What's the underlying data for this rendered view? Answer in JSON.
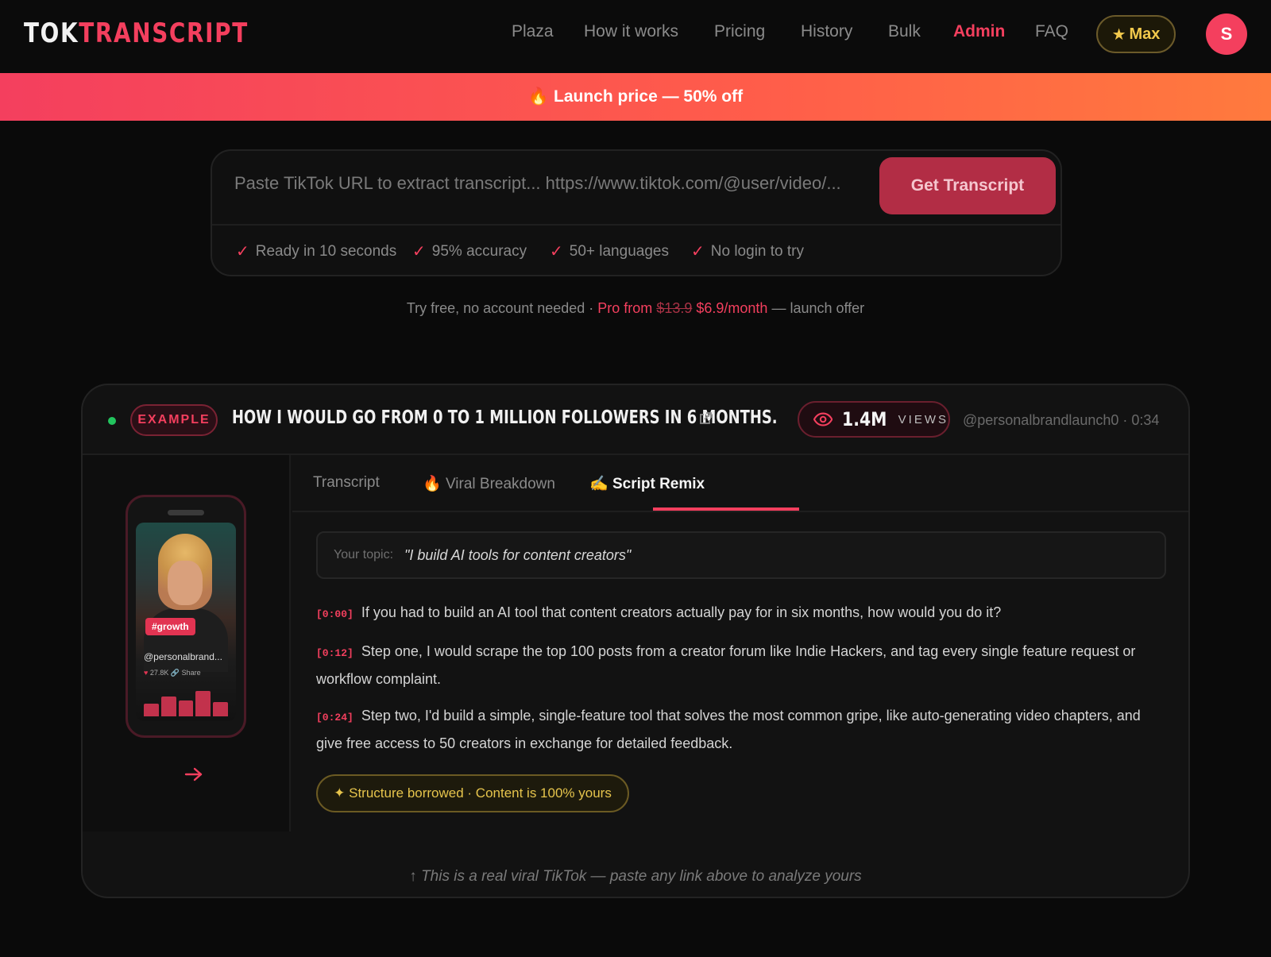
{
  "header": {
    "logo_part1": "TOK",
    "logo_part2": "TRANSCRIPT",
    "nav": [
      "Plaza",
      "How it works",
      "Pricing",
      "History",
      "Bulk",
      "Admin",
      "FAQ"
    ],
    "active_nav": "Admin",
    "max_label": "Max",
    "avatar_initial": "S"
  },
  "banner": {
    "emoji": "🔥",
    "text": "Launch price — 50% off"
  },
  "search": {
    "placeholder": "Paste TikTok URL to extract transcript... https://www.tiktok.com/@user/video/...",
    "button": "Get Transcript",
    "features": [
      "Ready in 10 seconds",
      "95% accuracy",
      "50+ languages",
      "No login to try"
    ]
  },
  "tagline": {
    "prefix": "Try free, no account needed · ",
    "pro_from": "Pro from",
    "old_price": "$13.9",
    "new_price": "$6.9/month",
    "suffix": " — launch offer"
  },
  "example": {
    "badge": "EXAMPLE",
    "title": "HOW I WOULD GO FROM 0 TO 1 MILLION FOLLOWERS IN 6 MONTHS.",
    "views_number": "1.4M",
    "views_label": "VIEWS",
    "author": "@personalbrandlaunch0 · 0:34",
    "phone": {
      "hashtag": "#growth",
      "handle": "@personalbrand...",
      "likes": "27.8K",
      "share": "Share",
      "bar_levels": [
        0.45,
        0.7,
        0.55,
        0.9,
        0.5
      ]
    },
    "tabs": [
      {
        "label": "Transcript",
        "icon": ""
      },
      {
        "label": "Viral Breakdown",
        "icon": "🔥"
      },
      {
        "label": "Script Remix",
        "icon": "✍️"
      }
    ],
    "active_tab": "Script Remix",
    "topic_label": "Your topic:",
    "topic_value": "\"I build AI tools for content creators\"",
    "lines": [
      {
        "ts": "[0:00]",
        "text": "If you had to build an AI tool that content creators actually pay for in six months, how would you do it?"
      },
      {
        "ts": "[0:12]",
        "text": "Step one, I would scrape the top 100 posts from a creator forum like Indie Hackers, and tag every single feature request or workflow complaint."
      },
      {
        "ts": "[0:24]",
        "text": "Step two, I'd build a simple, single-feature tool that solves the most common gripe, like auto-generating video chapters, and give free access to 50 creators in exchange for detailed feedback."
      }
    ],
    "borrowed_note": "✦ Structure borrowed · Content is 100% yours",
    "footnote": "↑ This is a real viral TikTok — paste any link above to analyze yours"
  },
  "colors": {
    "accent": "#f43f5e",
    "gold": "#e6c44c",
    "bg": "#0a0a0a"
  }
}
